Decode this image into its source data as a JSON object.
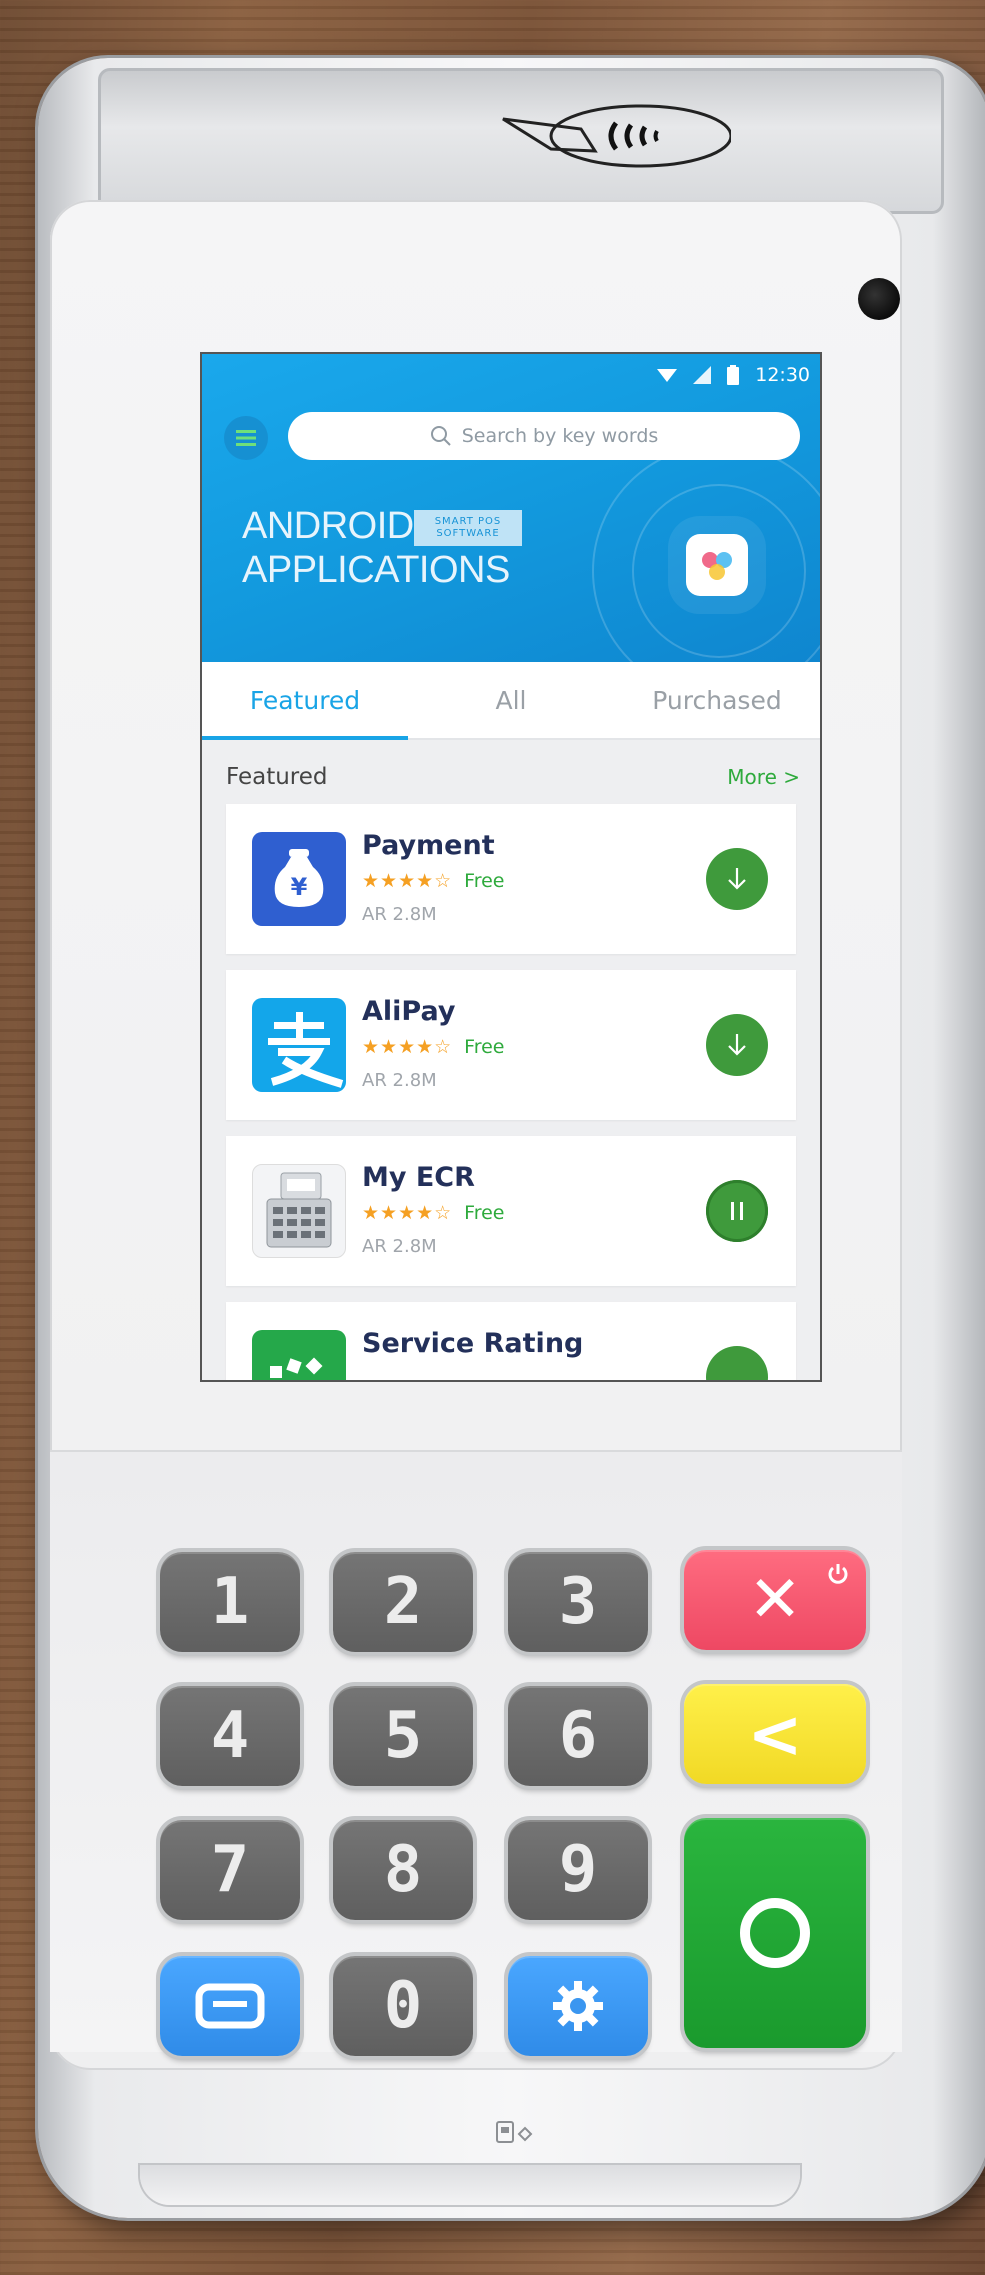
{
  "status_bar": {
    "time": "12:30"
  },
  "hero": {
    "search_placeholder": "Search by key words",
    "title_line1": "ANDROID",
    "title_line2": "APPLICATIONS",
    "tag_line1": "SMART POS",
    "tag_line2": "SOFTWARE"
  },
  "tabs": [
    {
      "label": "Featured",
      "active": true
    },
    {
      "label": "All",
      "active": false
    },
    {
      "label": "Purchased",
      "active": false
    }
  ],
  "section": {
    "title": "Featured",
    "more": "More >"
  },
  "apps": [
    {
      "name": "Payment",
      "stars": "★★★★☆",
      "price": "Free",
      "meta": "AR 2.8M",
      "action": "download"
    },
    {
      "name": "AliPay",
      "stars": "★★★★☆",
      "price": "Free",
      "meta": "AR 2.8M",
      "action": "download"
    },
    {
      "name": "My ECR",
      "stars": "★★★★☆",
      "price": "Free",
      "meta": "AR 2.8M",
      "action": "pause"
    },
    {
      "name": "Service Rating",
      "stars": "",
      "price": "",
      "meta": "",
      "action": "download"
    }
  ],
  "keypad": {
    "k1": "1",
    "k2": "2",
    "k3": "3",
    "k4": "4",
    "k5": "5",
    "k6": "6",
    "k7": "7",
    "k8": "8",
    "k9": "9",
    "k0": "0",
    "cancel": "✕",
    "back": "<"
  },
  "colors": {
    "accent_blue": "#19a4e6",
    "download_green": "#3f9a3c",
    "star_orange": "#f5a023",
    "key_red": "#ee4863",
    "key_yellow": "#f1d925",
    "key_green": "#1a9a2d"
  }
}
